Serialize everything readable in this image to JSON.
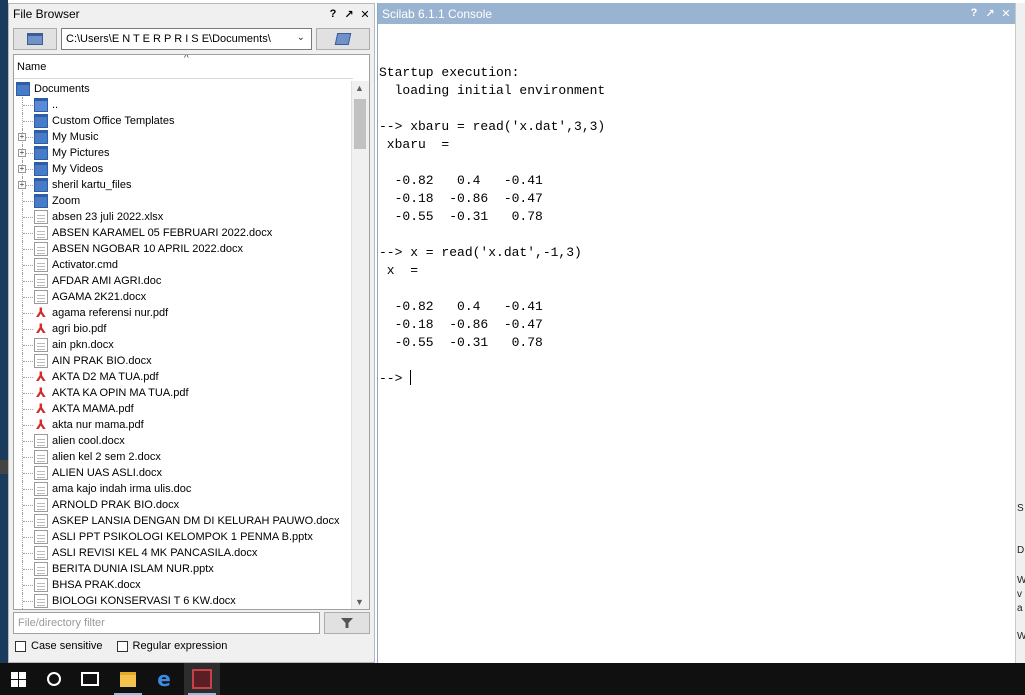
{
  "file_browser": {
    "title": "File Browser",
    "title_buttons": [
      "?",
      "↗",
      "✕"
    ],
    "path": "C:\\Users\\E N T E R P R I S E\\Documents\\",
    "column_name": "Name",
    "tree": [
      {
        "label": "Documents",
        "kind": "folder-root"
      },
      {
        "label": "..",
        "kind": "up"
      },
      {
        "label": "Custom Office Templates",
        "kind": "folder"
      },
      {
        "label": "My Music",
        "kind": "folder-exp"
      },
      {
        "label": "My Pictures",
        "kind": "folder-exp"
      },
      {
        "label": "My Videos",
        "kind": "folder-exp"
      },
      {
        "label": "sheril kartu_files",
        "kind": "folder-exp"
      },
      {
        "label": "Zoom",
        "kind": "folder"
      },
      {
        "label": "absen 23 juli 2022.xlsx",
        "kind": "doc"
      },
      {
        "label": "ABSEN KARAMEL 05 FEBRUARI 2022.docx",
        "kind": "doc"
      },
      {
        "label": "ABSEN NGOBAR 10 APRIL 2022.docx",
        "kind": "doc"
      },
      {
        "label": "Activator.cmd",
        "kind": "doc"
      },
      {
        "label": "AFDAR AMI AGRI.doc",
        "kind": "doc"
      },
      {
        "label": "AGAMA 2K21.docx",
        "kind": "doc"
      },
      {
        "label": "agama referensi nur.pdf",
        "kind": "pdf"
      },
      {
        "label": "agri bio.pdf",
        "kind": "pdf"
      },
      {
        "label": "ain pkn.docx",
        "kind": "doc"
      },
      {
        "label": "AIN PRAK BIO.docx",
        "kind": "doc"
      },
      {
        "label": "AKTA D2 MA TUA.pdf",
        "kind": "pdf"
      },
      {
        "label": "AKTA KA OPIN MA TUA.pdf",
        "kind": "pdf"
      },
      {
        "label": "AKTA MAMA.pdf",
        "kind": "pdf"
      },
      {
        "label": "akta nur mama.pdf",
        "kind": "pdf"
      },
      {
        "label": "alien cool.docx",
        "kind": "doc"
      },
      {
        "label": "alien kel 2 sem 2.docx",
        "kind": "doc"
      },
      {
        "label": "ALIEN UAS ASLI.docx",
        "kind": "doc"
      },
      {
        "label": "ama kajo indah irma ulis.doc",
        "kind": "doc"
      },
      {
        "label": "ARNOLD PRAK BIO.docx",
        "kind": "doc"
      },
      {
        "label": "ASKEP LANSIA DENGAN DM DI KELURAH PAUWO.docx",
        "kind": "doc"
      },
      {
        "label": "ASLI PPT PSIKOLOGI KELOMPOK 1 PENMA B.pptx",
        "kind": "doc"
      },
      {
        "label": "ASLI REVISI KEL 4 MK PANCASILA.docx",
        "kind": "doc"
      },
      {
        "label": "BERITA DUNIA ISLAM  NUR.pptx",
        "kind": "doc"
      },
      {
        "label": "BHSA PRAK.docx",
        "kind": "doc"
      },
      {
        "label": "BIOLOGI KONSERVASI T 6 KW.docx",
        "kind": "doc"
      }
    ],
    "filter_placeholder": "File/directory filter",
    "case_sensitive": "Case sensitive",
    "regular_expression": "Regular expression"
  },
  "console": {
    "title": "Scilab 6.1.1 Console",
    "title_buttons": [
      "?",
      "↗",
      "✕"
    ],
    "lines": [
      "Startup execution:",
      "  loading initial environment",
      "",
      "--> xbaru = read('x.dat',3,3)",
      " xbaru  =",
      "",
      "  -0.82   0.4   -0.41",
      "  -0.18  -0.86  -0.47",
      "  -0.55  -0.31   0.78",
      "",
      "--> x = read('x.dat',-1,3)",
      " x  =",
      "",
      "  -0.82   0.4   -0.41",
      "  -0.18  -0.86  -0.47",
      "  -0.55  -0.31   0.78",
      "",
      "--> "
    ]
  },
  "right_edge_fragments": [
    "S",
    "D",
    "W",
    "v",
    "a",
    "W"
  ],
  "taskbar": {
    "items": [
      "start",
      "search",
      "task-view",
      "file-explorer",
      "edge",
      "scilab"
    ]
  }
}
